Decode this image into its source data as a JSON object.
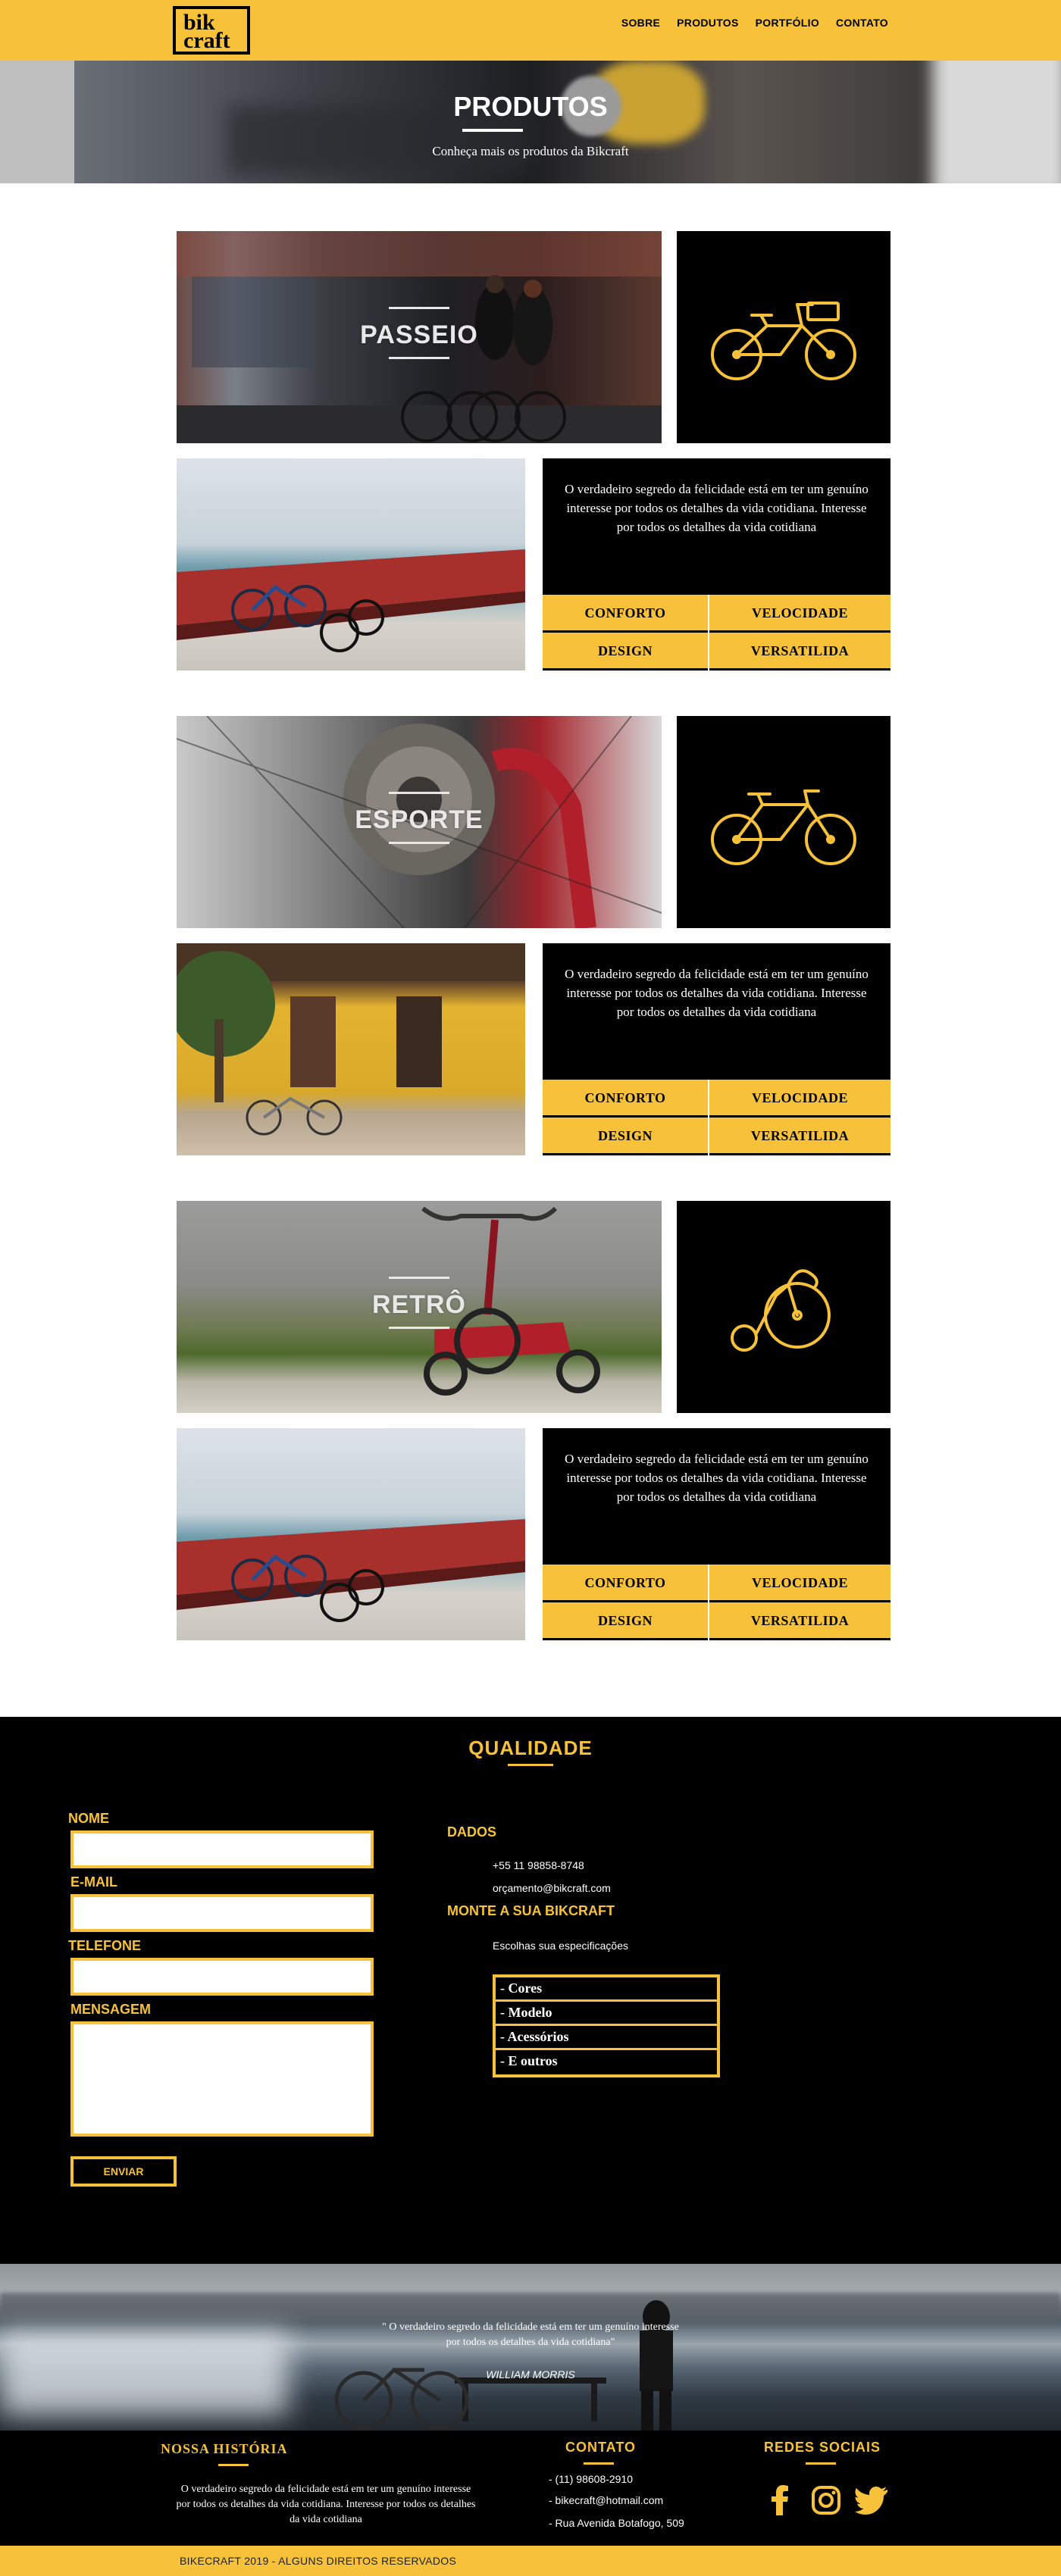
{
  "colors": {
    "accent": "#f8c13a",
    "dark": "#000000",
    "light": "#ffffff"
  },
  "header": {
    "logo_line1": "bik",
    "logo_line2": "craft",
    "nav": [
      "SOBRE",
      "PRODUTOS",
      "PORTFÓLIO",
      "CONTATO"
    ]
  },
  "banner": {
    "title": "PRODUTOS",
    "subtitle": "Conheça mais os produtos da Bikcraft"
  },
  "products": [
    {
      "name": "PASSEIO",
      "icon": "bike-basket-icon",
      "description": "O verdadeiro segredo da felicidade está em ter um genuíno interesse por todos os detalhes da vida cotidiana. Interesse por todos os detalhes da vida cotidiana",
      "features": [
        "CONFORTO",
        "VELOCIDADE",
        "DESIGN",
        "VERSATILIDA"
      ]
    },
    {
      "name": "ESPORTE",
      "icon": "bike-sport-icon",
      "description": "O verdadeiro segredo da felicidade está em ter um genuíno interesse por todos os detalhes da vida cotidiana. Interesse por todos os detalhes da vida cotidiana",
      "features": [
        "CONFORTO",
        "VELOCIDADE",
        "DESIGN",
        "VERSATILIDA"
      ]
    },
    {
      "name": "RETRÔ",
      "icon": "penny-farthing-icon",
      "description": "O verdadeiro segredo da felicidade está em ter um genuíno interesse por todos os detalhes da vida cotidiana. Interesse por todos os detalhes da vida cotidiana",
      "features": [
        "CONFORTO",
        "VELOCIDADE",
        "DESIGN",
        "VERSATILIDA"
      ]
    }
  ],
  "quality": {
    "title": "QUALIDADE",
    "form": {
      "name_label": "NOME",
      "email_label": "E-MAIL",
      "phone_label": "TELEFONE",
      "message_label": "MENSAGEM",
      "name_value": "",
      "email_value": "",
      "phone_value": "",
      "message_value": "",
      "submit_label": "ENVIAR"
    },
    "data_title": "DADOS",
    "phone": "+55 11 98858-8748",
    "email": "orçamento@bikcraft.com",
    "build_title": "MONTE A SUA BIKCRAFT",
    "build_subtitle": "Escolhas sua especificações",
    "options": [
      "- Cores",
      "- Modelo",
      "- Acessórios",
      "- E outros"
    ]
  },
  "quote": {
    "text": "\" O verdadeiro segredo da felicidade está em ter um genuíno interesse por todos os detalhes da vida cotidiana\"",
    "author": "WILLIAM MORRIS"
  },
  "footer": {
    "history_title": "NOSSA HISTÓRIA",
    "history_text": "O verdadeiro segredo da felicidade está em ter um genuíno interesse por todos os detalhes da vida cotidiana. Interesse por todos os detalhes da vida cotidiana",
    "contact_title": "CONTATO",
    "contact_items": [
      "- (11) 98608-2910",
      "- bikecraft@hotmail.com",
      "- Rua Avenida Botafogo, 509"
    ],
    "social_title": "REDES  SOCIAIS",
    "social_icons": [
      "facebook-icon",
      "instagram-icon",
      "twitter-icon"
    ],
    "copyright": "BIKECRAFT 2019 - ALGUNS DIREITOS RESERVADOS"
  }
}
